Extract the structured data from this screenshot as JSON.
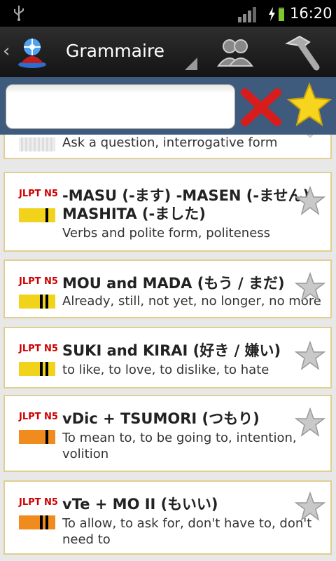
{
  "status": {
    "time": "16:20"
  },
  "actionbar": {
    "title": "Grammaire"
  },
  "search": {
    "value": "",
    "placeholder": ""
  },
  "items": [
    {
      "level": "",
      "title": "",
      "desc": "Ask a question, interrogative form"
    },
    {
      "level": "JLPT N5",
      "title": "-MASU (-ます) -MASEN (-ません)",
      "title2": "MASHITA (-ました)",
      "desc": "Verbs and polite form, politeness",
      "belt_color": "#f2d31b"
    },
    {
      "level": "JLPT N5",
      "title": "MOU and MADA (もう / まだ)",
      "desc": "Already, still, not yet, no longer, no more",
      "belt_color": "#f2d31b"
    },
    {
      "level": "JLPT N5",
      "title": "SUKI and KIRAI (好き / 嫌い)",
      "desc": "to like, to love, to dislike, to hate",
      "belt_color": "#f2d31b"
    },
    {
      "level": "JLPT N5",
      "title": "vDic + TSUMORI (つもり)",
      "desc": "To mean to, to be going to, intention, volition",
      "belt_color": "#f08c1e"
    },
    {
      "level": "JLPT N5",
      "title": "vTe + MO II (もいい)",
      "desc": "To allow, to ask for, don't have to, don't need to",
      "belt_color": "#f08c1e"
    }
  ]
}
